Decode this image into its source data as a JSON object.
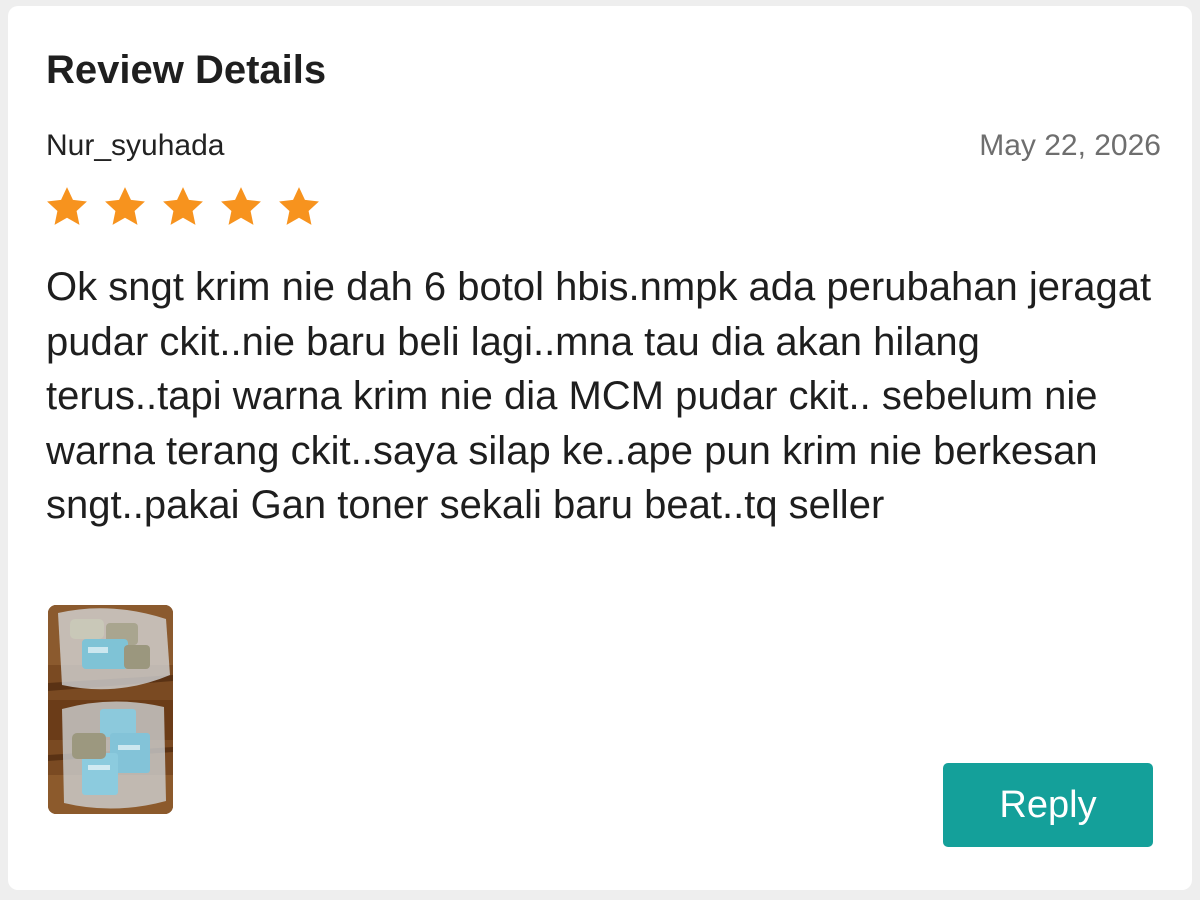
{
  "header": {
    "title": "Review Details"
  },
  "review": {
    "reviewer": "Nur_syuhada",
    "date": "May 22, 2026",
    "rating": 5,
    "rating_max": 5,
    "text": "Ok sngt krim nie dah 6 botol hbis.nmpk ada perubahan jeragat pudar ckit..nie baru beli lagi..mna tau dia akan hilang terus..tapi warna krim nie dia MCM pudar ckit.. sebelum nie warna terang ckit..saya silap ke..ape pun krim nie berkesan sngt..pakai Gan toner sekali baru beat..tq seller",
    "photo_icon": "review-photo-thumbnail"
  },
  "actions": {
    "reply_label": "Reply"
  },
  "colors": {
    "star": "#f7931e",
    "accent": "#14a09a",
    "date_text": "#6e6e6e"
  }
}
